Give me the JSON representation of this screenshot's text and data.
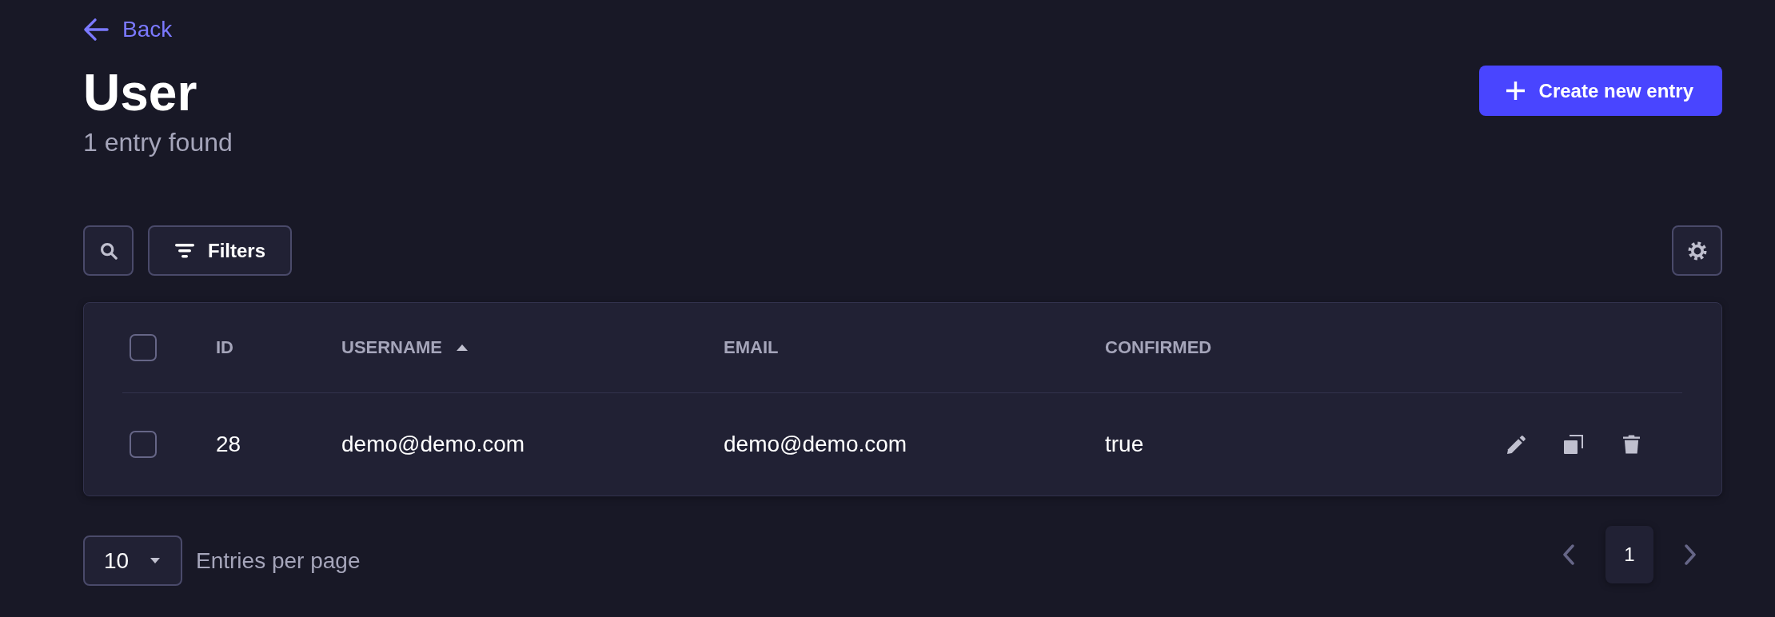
{
  "back_link": {
    "label": "Back"
  },
  "header": {
    "title": "User",
    "subtitle": "1 entry found",
    "create_button": {
      "label": "Create new entry"
    }
  },
  "toolbar": {
    "filters_button": {
      "label": "Filters"
    }
  },
  "table": {
    "select_all": {
      "checked": false
    },
    "columns": [
      {
        "label": "ID",
        "sorted": false
      },
      {
        "label": "USERNAME",
        "sorted": true
      },
      {
        "label": "EMAIL",
        "sorted": false
      },
      {
        "label": "CONFIRMED",
        "sorted": false
      }
    ],
    "rows": [
      {
        "checked": false,
        "cells": [
          "28",
          "demo@demo.com",
          "demo@demo.com",
          "true"
        ]
      }
    ]
  },
  "footer": {
    "per_page": {
      "value": "10",
      "label": "Entries per page"
    },
    "pagination": {
      "pages": [
        {
          "label": "1",
          "selected": true
        }
      ]
    }
  }
}
